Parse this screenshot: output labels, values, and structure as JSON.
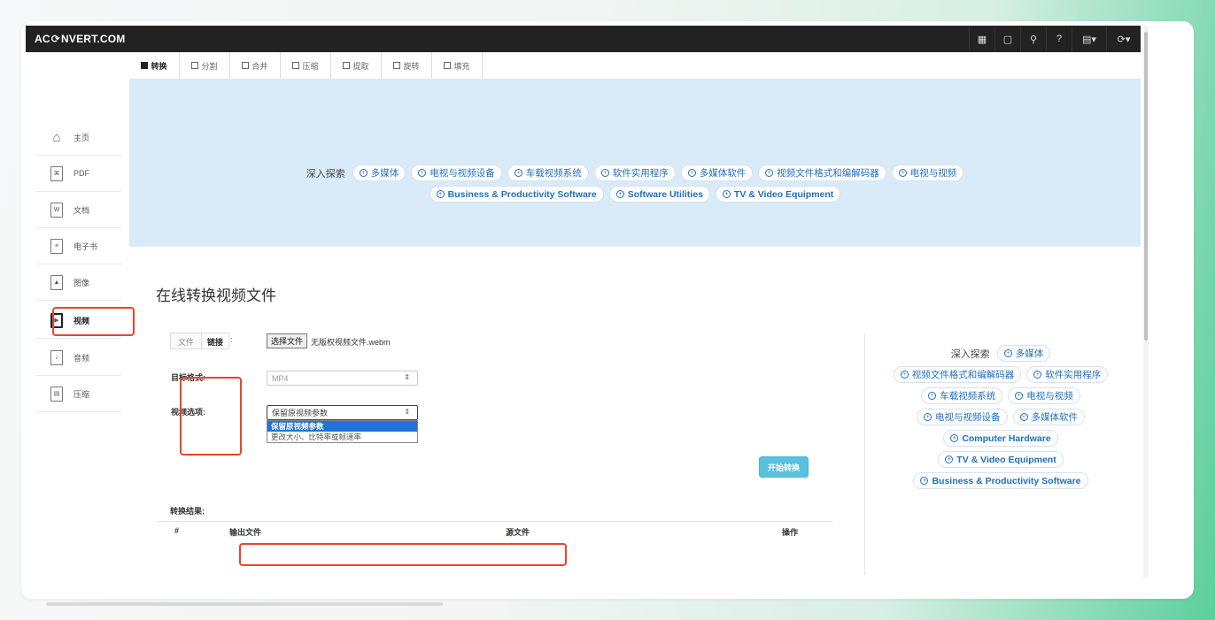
{
  "app": {
    "logo_left": "AC",
    "logo_right": "NVERT.COM",
    "toolbar_icons": [
      "grid-icon",
      "tablet-icon",
      "search-icon",
      "help-icon",
      "language-icon",
      "refresh-icon"
    ]
  },
  "sidebar": {
    "items": [
      {
        "label": "主页",
        "icon": "home-icon",
        "glyph": "🏠"
      },
      {
        "label": "PDF",
        "icon": "pdf-icon",
        "glyph": "⌘"
      },
      {
        "label": "文档",
        "icon": "word-icon",
        "glyph": "W"
      },
      {
        "label": "电子书",
        "icon": "ebook-icon",
        "glyph": "≡"
      },
      {
        "label": "图像",
        "icon": "image-icon",
        "glyph": "▲"
      },
      {
        "label": "视频",
        "icon": "video-icon",
        "glyph": "▶"
      },
      {
        "label": "音频",
        "icon": "audio-icon",
        "glyph": "♪"
      },
      {
        "label": "压缩",
        "icon": "archive-icon",
        "glyph": "▤"
      }
    ],
    "active": "视频"
  },
  "tabs": [
    "转换",
    "分割",
    "合并",
    "压缩",
    "提取",
    "旋转",
    "填充"
  ],
  "banner": {
    "explore_label": "深入探索",
    "row1": [
      "多媒体",
      "电视与视频设备",
      "车载视频系统",
      "软件实用程序",
      "多媒体软件",
      "视频文件格式和编解码器",
      "电视与视频"
    ],
    "row2": [
      "Business & Productivity Software",
      "Software Utilities",
      "TV & Video Equipment"
    ]
  },
  "main": {
    "title": "在线转换视频文件",
    "source_tab_file": "文件",
    "source_tab_link": "链接",
    "source_colon": ":",
    "choose_file": "选择文件",
    "file_name": "无版权视频文件.webm",
    "target_format_label": "目标格式:",
    "target_format_value": "MP4",
    "video_options_label": "视频选项:",
    "video_options_value": "保留原视频参数",
    "video_options_list": [
      "保留原视频参数",
      "更改大小、比特率或帧速率"
    ],
    "start_button": "开始转换",
    "result_label": "转换结果:",
    "result_headers": {
      "index": "#",
      "output": "输出文件",
      "source": "源文件",
      "action": "操作"
    }
  },
  "right_explore": {
    "label": "深入探索",
    "rows": [
      [
        "多媒体"
      ],
      [
        "视频文件格式和编解码器",
        "软件实用程序"
      ],
      [
        "车载视频系统",
        "电视与视频"
      ],
      [
        "电视与视频设备",
        "多媒体软件"
      ],
      [
        "Computer Hardware"
      ],
      [
        "TV & Video Equipment"
      ],
      [
        "Business & Productivity Software"
      ]
    ]
  },
  "colors": {
    "highlight": "#e8452c",
    "banner_bg": "#d9ebf9",
    "link": "#1f6fbf",
    "start_button": "#5bc0de"
  }
}
